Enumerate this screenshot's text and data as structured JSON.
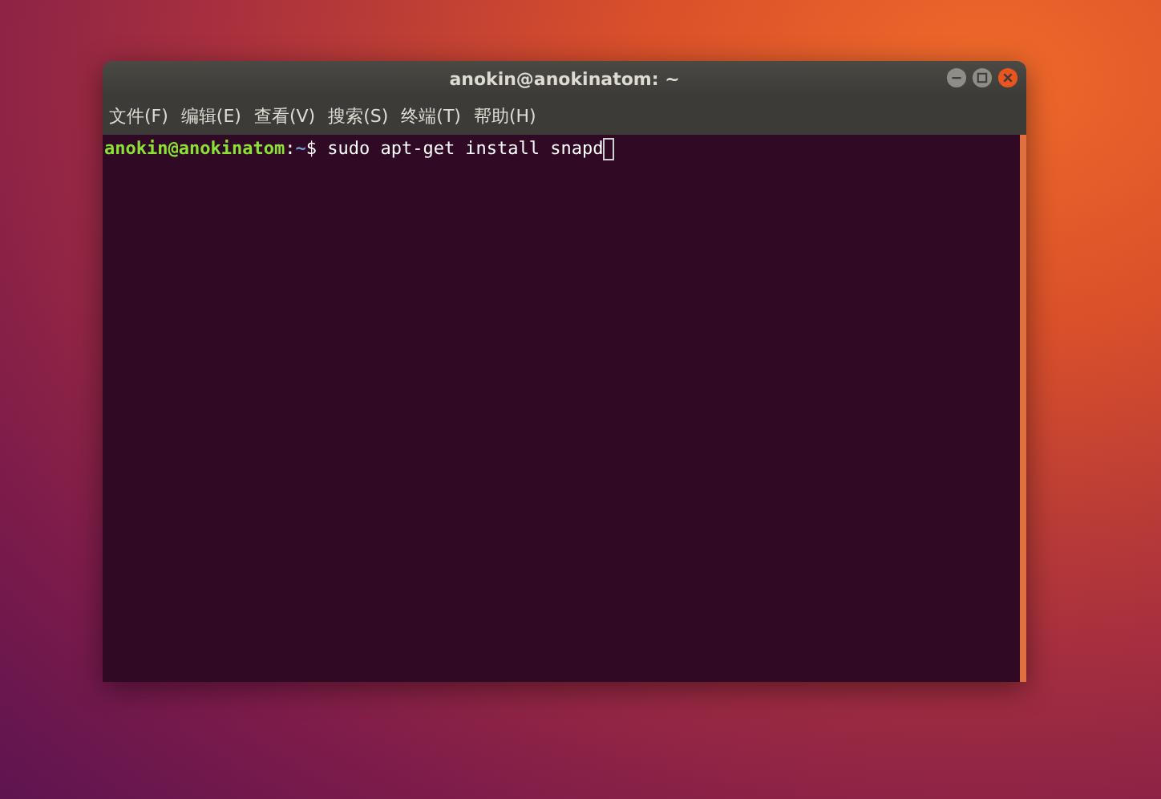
{
  "window": {
    "title": "anokin@anokinatom: ~"
  },
  "menu": [
    "文件(F)",
    "编辑(E)",
    "查看(V)",
    "搜索(S)",
    "终端(T)",
    "帮助(H)"
  ],
  "terminal": {
    "lines": [
      {
        "user_host": "anokin@anokinatom",
        "separator": ":",
        "path": "~",
        "symbol": "$",
        "command": "sudo apt-get install snapd"
      }
    ]
  }
}
